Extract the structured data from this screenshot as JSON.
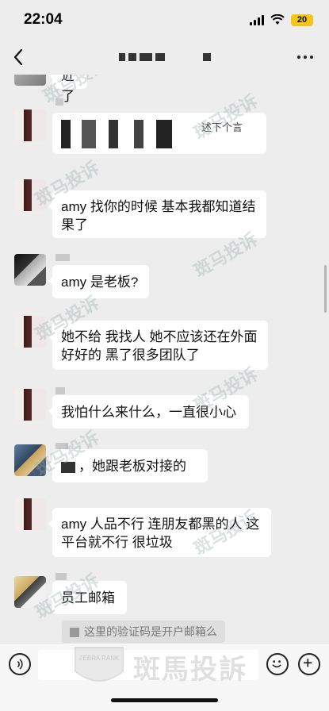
{
  "status_bar": {
    "time": "22:04",
    "battery": "20"
  },
  "nav": {
    "back_icon": "chevron-left-icon",
    "more_icon": "more-dots-icon"
  },
  "messages": [
    {
      "text": "近了"
    },
    {
      "text": "述下个言"
    },
    {
      "text": "amy 找你的时候 基本我都知道结果了"
    },
    {
      "text": "amy 是老板?"
    },
    {
      "text": "她不给 我找人 她不应该还在外面好好的 黑了很多团队了"
    },
    {
      "text": "我怕什么来什么，一直很小心"
    },
    {
      "text": "，她跟老板对接的"
    },
    {
      "text": "amy 人品不行 连朋友都黑的人 这平台就不行 很垃圾"
    },
    {
      "text": "员工邮箱"
    }
  ],
  "system_message": "这里的验证码是开户邮箱么",
  "watermark": {
    "text": "斑马投诉",
    "brand_cn": "斑馬投訴",
    "brand_en": "ZEBRA RANK"
  },
  "input_bar": {
    "voice_icon": "voice-icon",
    "emoji_icon": "emoji-icon",
    "plus_icon": "plus-icon"
  },
  "colors": {
    "background": "#ededed",
    "bubble": "#ffffff",
    "battery": "#f5c518"
  }
}
